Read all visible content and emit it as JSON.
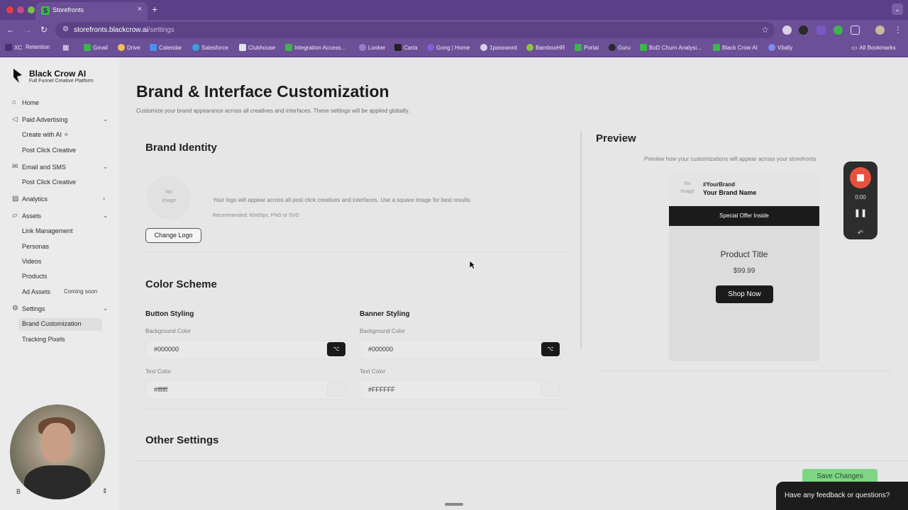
{
  "browser": {
    "tab_title": "Storefronts",
    "url_host": "storefronts.blackcrow.ai",
    "url_path": "/settings",
    "bookmarks": [
      "XC",
      "Retention",
      "Gmail",
      "Drive",
      "Calendar",
      "Salesforce",
      "Clubhouse",
      "Integration Access...",
      "Looker",
      "Carta",
      "Gong | Home",
      "1password",
      "BambooHR",
      "Portal",
      "Guru",
      "BoD Churn Analysi...",
      "Black Crow AI",
      "Vitally"
    ],
    "all_bookmarks": "All Bookmarks"
  },
  "sidebar": {
    "brand": "Black Crow AI",
    "tagline": "Full Funnel Creative Platform",
    "home": "Home",
    "paid_advertising": "Paid Advertising",
    "create_with_ai": "Create with AI",
    "post_click_1": "Post Click Creative",
    "email_sms": "Email and SMS",
    "post_click_2": "Post Click Creative",
    "analytics": "Analytics",
    "assets": "Assets",
    "link_management": "Link Management",
    "personas": "Personas",
    "videos": "Videos",
    "products": "Products",
    "ad_assets": "Ad Assets",
    "coming_soon": "Coming soon",
    "settings": "Settings",
    "brand_customization": "Brand Customization",
    "tracking_pixels": "Tracking Pixels",
    "account_initial": "B"
  },
  "main": {
    "title": "Brand & Interface Customization",
    "description": "Customize your brand appearance across all creatives and interfaces. These settings will be applied globally.",
    "brand_identity": {
      "heading": "Brand Identity",
      "no_image_1": "No",
      "no_image_2": "Image",
      "logo_hint": "Your logo will appear across all post click creatives and interfaces. Use a square image for best results.",
      "recommended": "Recommended: 60x60px, PNG or SVG",
      "change_logo": "Change Logo"
    },
    "color_scheme": {
      "heading": "Color Scheme",
      "button_styling": "Button Styling",
      "banner_styling": "Banner Styling",
      "bg_label": "Background Color",
      "text_label": "Text Color",
      "button_bg": "#000000",
      "button_text": "#ffffff",
      "banner_bg": "#000000",
      "banner_text": "#FFFFFF"
    },
    "other_settings": "Other Settings"
  },
  "preview": {
    "heading": "Preview",
    "description": "Preview how your customizations will appear across your storefronts",
    "no_image_1": "No",
    "no_image_2": "Image",
    "handle": "#YourBrand",
    "brand_name": "Your Brand Name",
    "banner": "Special Offer Inside",
    "product_title": "Product Title",
    "price": "$99.99",
    "shop_now": "Shop Now"
  },
  "recorder": {
    "time": "0:00"
  },
  "save_changes": "Save Changes",
  "feedback": "Have any feedback or questions?",
  "colors": {
    "accent_purple": "#6b4f97",
    "save_green": "#7ed685",
    "record_red": "#e9513f"
  }
}
